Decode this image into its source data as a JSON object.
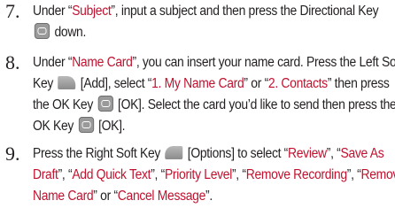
{
  "steps": [
    {
      "number": "7.",
      "lines": [
        [
          "Under “",
          {
            "hl": "Subject"
          },
          "”, input a subject and then press the Directional Key"
        ],
        [
          {
            "key": "ok"
          },
          " down."
        ]
      ]
    },
    {
      "number": "8.",
      "lines": [
        [
          "Under “",
          {
            "hl": "Name Card"
          },
          "”, you can insert your name card. Press the Left Soft"
        ],
        [
          "Key ",
          {
            "key": "soft-left"
          },
          " [Add], select “",
          {
            "hl": "1. My Name Card"
          },
          "” or “",
          {
            "hl": "2. Contacts"
          },
          "” then press"
        ],
        [
          "the OK Key ",
          {
            "key": "ok"
          },
          " [OK]. Select the card you’d like to send then press the"
        ],
        [
          "OK Key ",
          {
            "key": "ok"
          },
          " [OK]."
        ]
      ]
    },
    {
      "number": "9.",
      "lines": [
        [
          "Press the Right Soft Key ",
          {
            "key": "soft-right"
          },
          " [Options] to select “",
          {
            "hl": "Review"
          },
          "”, “",
          {
            "hl": "Save As"
          }
        ],
        [
          {
            "hl": "Draft"
          },
          "”, “",
          {
            "hl": "Add Quick Text"
          },
          "”, “",
          {
            "hl": "Priority Level"
          },
          "”, “",
          {
            "hl": "Remove Recording"
          },
          "”, “",
          {
            "hl": "Remove"
          }
        ],
        [
          {
            "hl": "Name Card"
          },
          "” or “",
          {
            "hl": "Cancel Message"
          },
          "”."
        ]
      ]
    }
  ],
  "colors": {
    "text": "#231f20",
    "highlight": "#c0122f",
    "key": "#9a9a9a"
  },
  "icons": {
    "ok": "ok-key-icon",
    "soft-left": "left-soft-key-icon",
    "soft-right": "right-soft-key-icon"
  }
}
